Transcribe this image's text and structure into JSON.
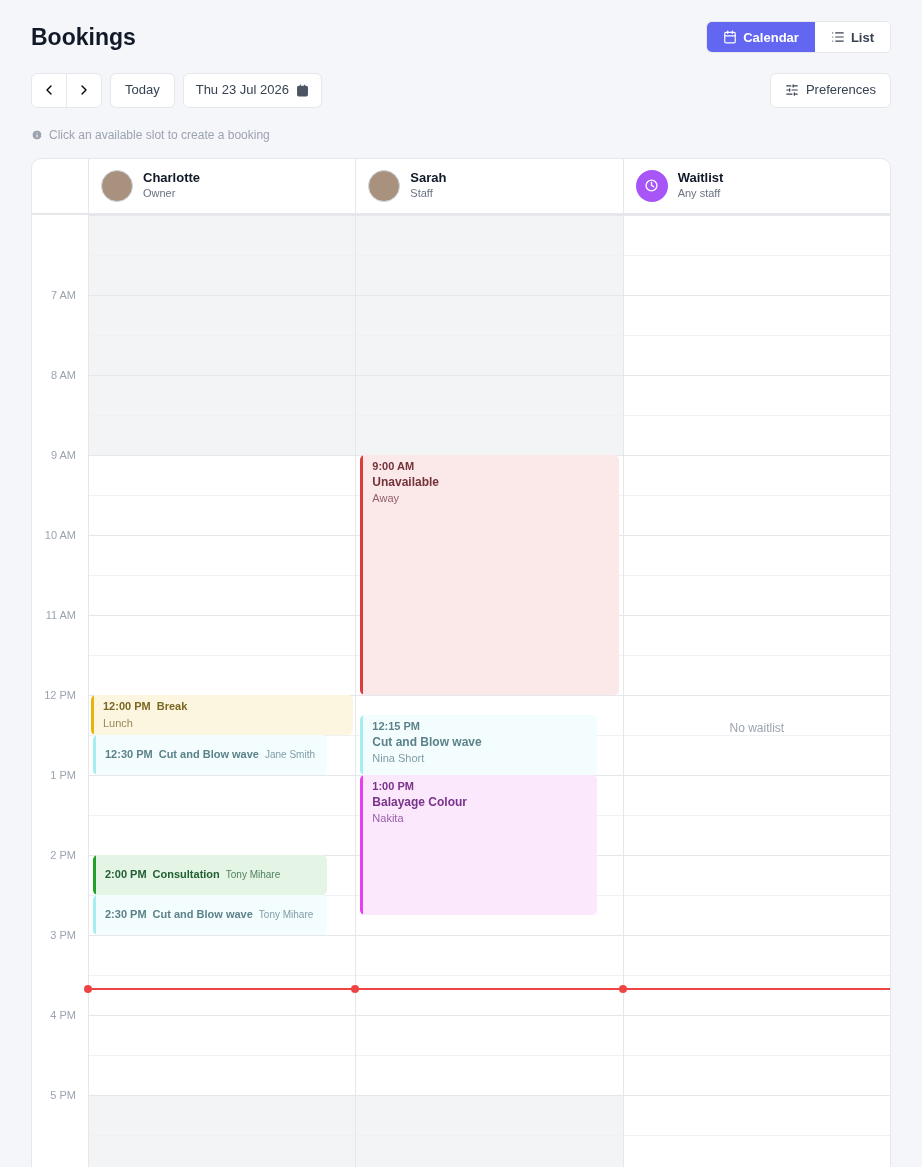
{
  "title": "Bookings",
  "view_tabs": [
    {
      "label": "Calendar",
      "selected": true
    },
    {
      "label": "List",
      "selected": false
    }
  ],
  "toolbar": {
    "today": "Today",
    "date": "Thu 23 Jul 2026",
    "preferences": "Preferences"
  },
  "hint": "Click an available slot to create a booking",
  "hours": [
    "7 AM",
    "8 AM",
    "9 AM",
    "10 AM",
    "11 AM",
    "12 PM",
    "1 PM",
    "2 PM",
    "3 PM",
    "4 PM",
    "5 PM"
  ],
  "columns": [
    {
      "kind": "person",
      "name": "Charlotte",
      "role": "Owner",
      "events": [
        {
          "kind": "split",
          "time": "12:00 PM",
          "title": "Break",
          "subtitle": "Lunch",
          "color": "#eab308"
        },
        {
          "kind": "inline",
          "time": "12:30 PM",
          "title": "Cut and Blow wave",
          "subtitle": "Jane Smith",
          "color": "#a5eef0"
        },
        {
          "kind": "inline",
          "time": "2:00 PM",
          "title": "Consultation",
          "subtitle": "Tony Mihare",
          "color": "#22a02a"
        },
        {
          "kind": "inline",
          "time": "2:30 PM",
          "title": "Cut and Blow wave",
          "subtitle": "Tony Mihare",
          "color": "#a5eef0"
        }
      ]
    },
    {
      "kind": "person",
      "name": "Sarah",
      "role": "Staff",
      "events": [
        {
          "kind": "stacked",
          "time": "9:00 AM",
          "title": "Unavailable",
          "subtitle": "Away",
          "color": "#dc3c3c"
        },
        {
          "kind": "stacked",
          "time": "12:15 PM",
          "title": "Cut and Blow wave",
          "subtitle": "Nina Short",
          "color": "#a5eef0"
        },
        {
          "kind": "stacked",
          "time": "1:00 PM",
          "title": "Balayage Colour",
          "subtitle": "Nakita",
          "color": "#e83ef0"
        }
      ]
    },
    {
      "kind": "queue",
      "name": "Waitlist",
      "role": "Any staff",
      "empty": "No waitlist"
    }
  ]
}
